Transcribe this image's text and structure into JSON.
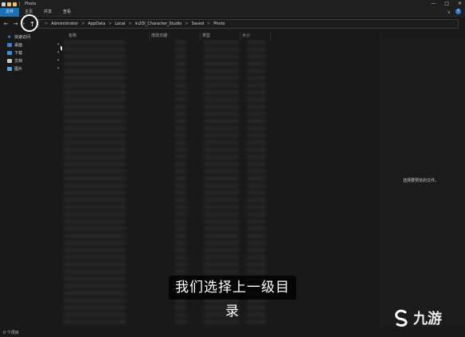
{
  "window": {
    "title": "Photo",
    "controls": [
      "—",
      "□",
      "✕"
    ]
  },
  "ribbon": {
    "tabs": [
      "文件",
      "主页",
      "共享",
      "查看"
    ],
    "active_tab": 0,
    "help_glyph": "?",
    "chevron_glyph": "∨"
  },
  "nav_buttons": {
    "back": "←",
    "forward": "→",
    "recent": "∨",
    "up": "↑"
  },
  "breadcrumb": [
    "Administrator",
    "AppData",
    "Local",
    "in2OI_Character_Studio",
    "Saved",
    "Photo"
  ],
  "breadcrumb_separator": ">",
  "nav_pane": {
    "items": [
      {
        "label": "快速访问",
        "icon": "star-icon",
        "color": "#3b8de0"
      },
      {
        "label": "桌面",
        "icon": "desktop-icon",
        "color": "#3a7bd5"
      },
      {
        "label": "下载",
        "icon": "download-icon",
        "color": "#3b8de0"
      },
      {
        "label": "文档",
        "icon": "document-icon",
        "color": "#c9c9c9"
      },
      {
        "label": "图片",
        "icon": "pictures-icon",
        "color": "#4fa3e0"
      }
    ],
    "pin_glyph": "✦"
  },
  "file_list": {
    "columns": [
      "名称",
      "修改日期",
      "类型",
      "大小"
    ]
  },
  "preview_pane": {
    "message": "选择要预览的文件。"
  },
  "status_bar": {
    "text": "0 个项目"
  },
  "caption": {
    "text": "我们选择上一级目录"
  },
  "watermark": {
    "text": "九游"
  },
  "colors": {
    "accent": "#1a6fb6",
    "folder": "#e8c46a",
    "background": "#191919"
  }
}
